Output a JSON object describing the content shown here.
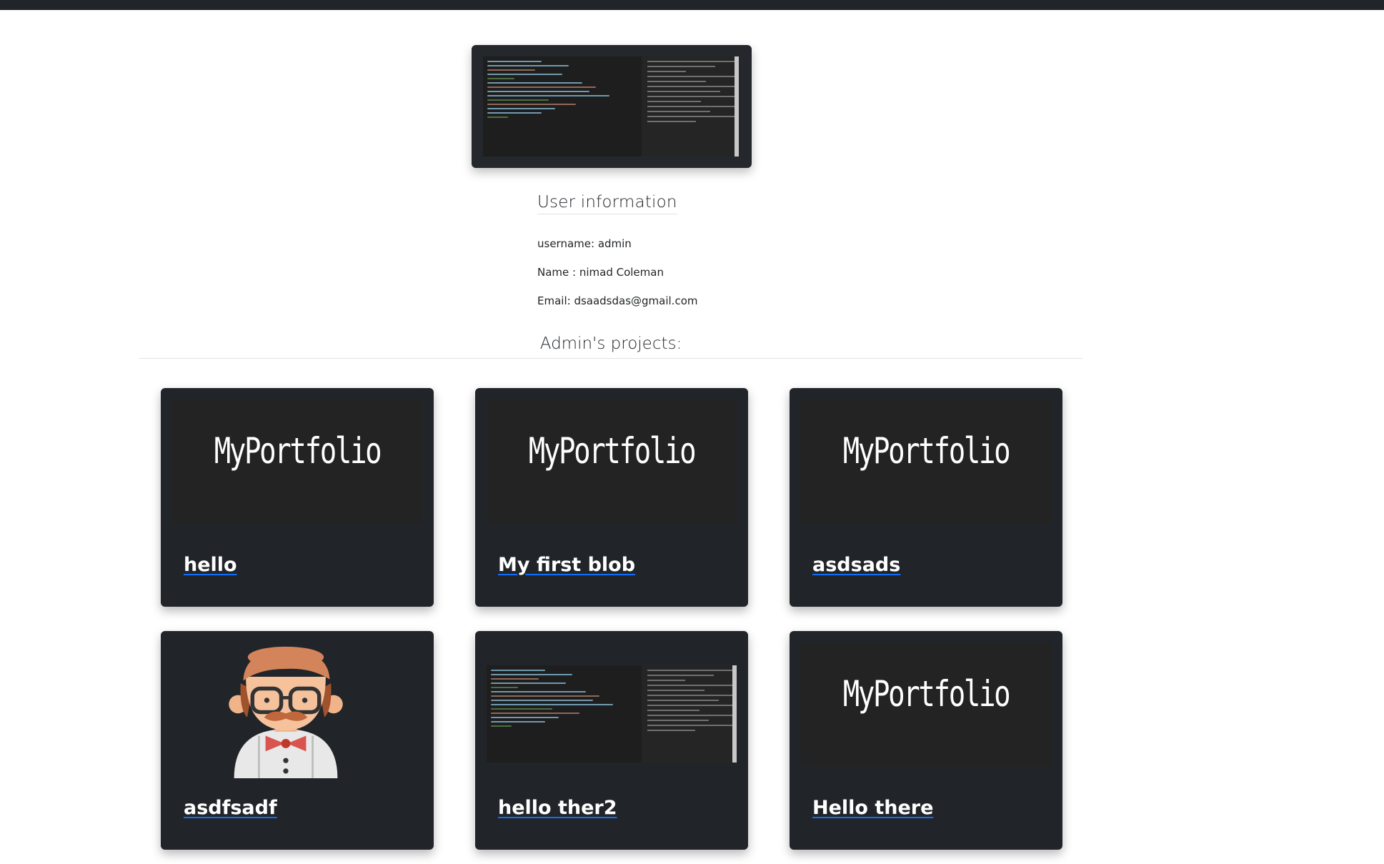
{
  "user_info": {
    "title": "User information",
    "username": "username: admin",
    "name": "Name : nimad Coleman",
    "email": "Email: dsaadsdas@gmail.com"
  },
  "projects": {
    "heading": "Admin's projects:",
    "items": [
      {
        "title": "hello",
        "thumbnail": "myportfolio-logo",
        "logo_text": "MyPortfolio"
      },
      {
        "title": "My first blob",
        "thumbnail": "myportfolio-logo",
        "logo_text": "MyPortfolio"
      },
      {
        "title": "asdsads",
        "thumbnail": "myportfolio-logo",
        "logo_text": "MyPortfolio"
      },
      {
        "title": "asdfsadf",
        "thumbnail": "avatar-illustration"
      },
      {
        "title": "hello ther2",
        "thumbnail": "code-screenshot"
      },
      {
        "title": "Hello there",
        "thumbnail": "myportfolio-logo",
        "logo_text": "MyPortfolio"
      }
    ]
  },
  "colors": {
    "topbar": "#212529",
    "card_bg": "#212529",
    "link_underline": "#0d6efd",
    "text": "#212529"
  }
}
